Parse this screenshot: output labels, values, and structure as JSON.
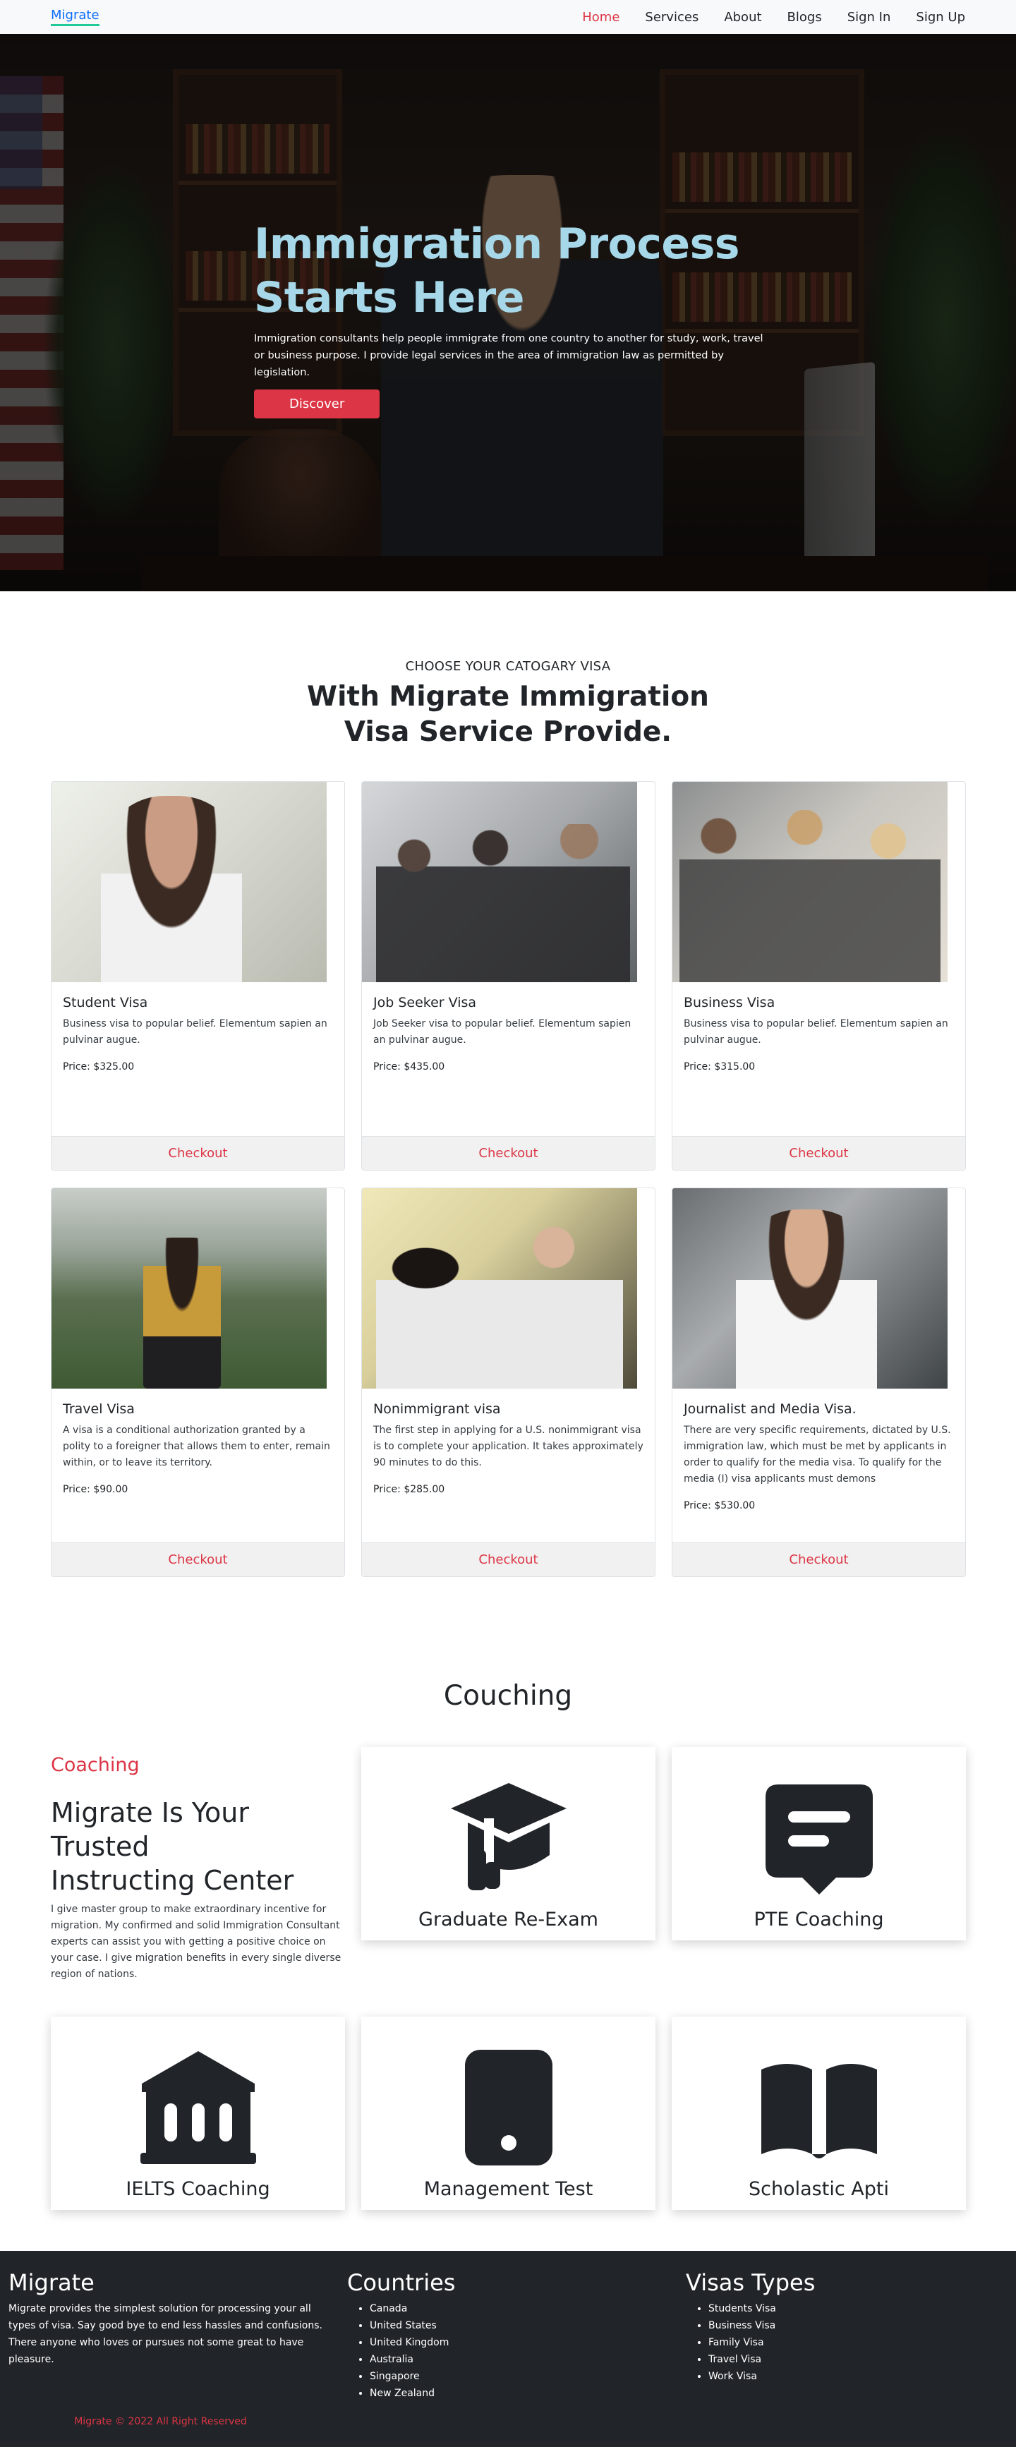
{
  "nav": {
    "brand": "Migrate",
    "links": [
      "Home",
      "Services",
      "About",
      "Blogs",
      "Sign In",
      "Sign Up"
    ]
  },
  "hero": {
    "title_line1": "Immigration Process",
    "title_line2": "Starts Here",
    "text": "Immigration consultants help people immigrate from one country to another for study, work, travel or business purpose. I provide legal services in the area of immigration law as permitted by legislation.",
    "button": "Discover"
  },
  "visa": {
    "eyebrow": "CHOOSE YOUR CATOGARY VISA",
    "heading_line1": "With Migrate Immigration",
    "heading_line2": "Visa Service Provide.",
    "checkout_label": "Checkout",
    "cards": [
      {
        "title": "Student Visa",
        "text": "Business visa to popular belief. Elementum sapien an pulvinar augue.",
        "price": "Price: $325.00"
      },
      {
        "title": "Job Seeker Visa",
        "text": "Job Seeker visa to popular belief. Elementum sapien an pulvinar augue.",
        "price": "Price: $435.00"
      },
      {
        "title": "Business Visa",
        "text": "Business visa to popular belief. Elementum sapien an pulvinar augue.",
        "price": "Price: $315.00"
      },
      {
        "title": "Travel Visa",
        "text": "A visa is a conditional authorization granted by a polity to a foreigner that allows them to enter, remain within, or to leave its territory.",
        "price": "Price: $90.00"
      },
      {
        "title": "Nonimmigrant visa",
        "text": "The first step in applying for a U.S. nonimmigrant visa is to complete your application. It takes approximately 90 minutes to do this.",
        "price": "Price: $285.00"
      },
      {
        "title": "Journalist and Media Visa.",
        "text": "There are very specific requirements, dictated by U.S. immigration law, which must be met by applicants in order to qualify for the media visa. To qualify for the media (I) visa applicants must demons",
        "price": "Price: $530.00"
      }
    ]
  },
  "coaching": {
    "heading": "Couching",
    "kicker": "Coaching",
    "title_line1": "Migrate Is Your",
    "title_line2": "Trusted",
    "title_line3": "Instructing Center",
    "text": "I give master group to make extraordinary incentive for migration. My confirmed and solid Immigration Consultant experts can assist you with getting a positive choice on your case. I give migration benefits in every single diverse region of nations.",
    "cards": [
      {
        "label": "Graduate Re-Exam",
        "icon": "graduation-cap-icon"
      },
      {
        "label": "PTE Coaching",
        "icon": "chat-message-icon"
      },
      {
        "label": "IELTS Coaching",
        "icon": "bank-building-icon"
      },
      {
        "label": "Management Test",
        "icon": "tablet-icon"
      },
      {
        "label": "Scholastic Apti",
        "icon": "open-book-icon"
      }
    ]
  },
  "footer": {
    "brand": "Migrate",
    "about": "Migrate provides the simplest solution for processing your all types of visa. Say good bye to end less hassles and confusions. There anyone who loves or pursues not some great to have pleasure.",
    "countries_title": "Countries",
    "countries": [
      "Canada",
      "United States",
      "United Kingdom",
      "Australia",
      "Singapore",
      "New Zealand"
    ],
    "visas_title": "Visas Types",
    "visas": [
      "Students Visa",
      "Business Visa",
      "Family Visa",
      "Travel Visa",
      "Work Visa"
    ],
    "copyright": "Migrate © 2022 All Right Reserved"
  },
  "colors": {
    "accent": "#dc3545",
    "brand_link": "#0d6efd",
    "hero_title": "#a6d8ea",
    "footer_bg": "#212529"
  }
}
